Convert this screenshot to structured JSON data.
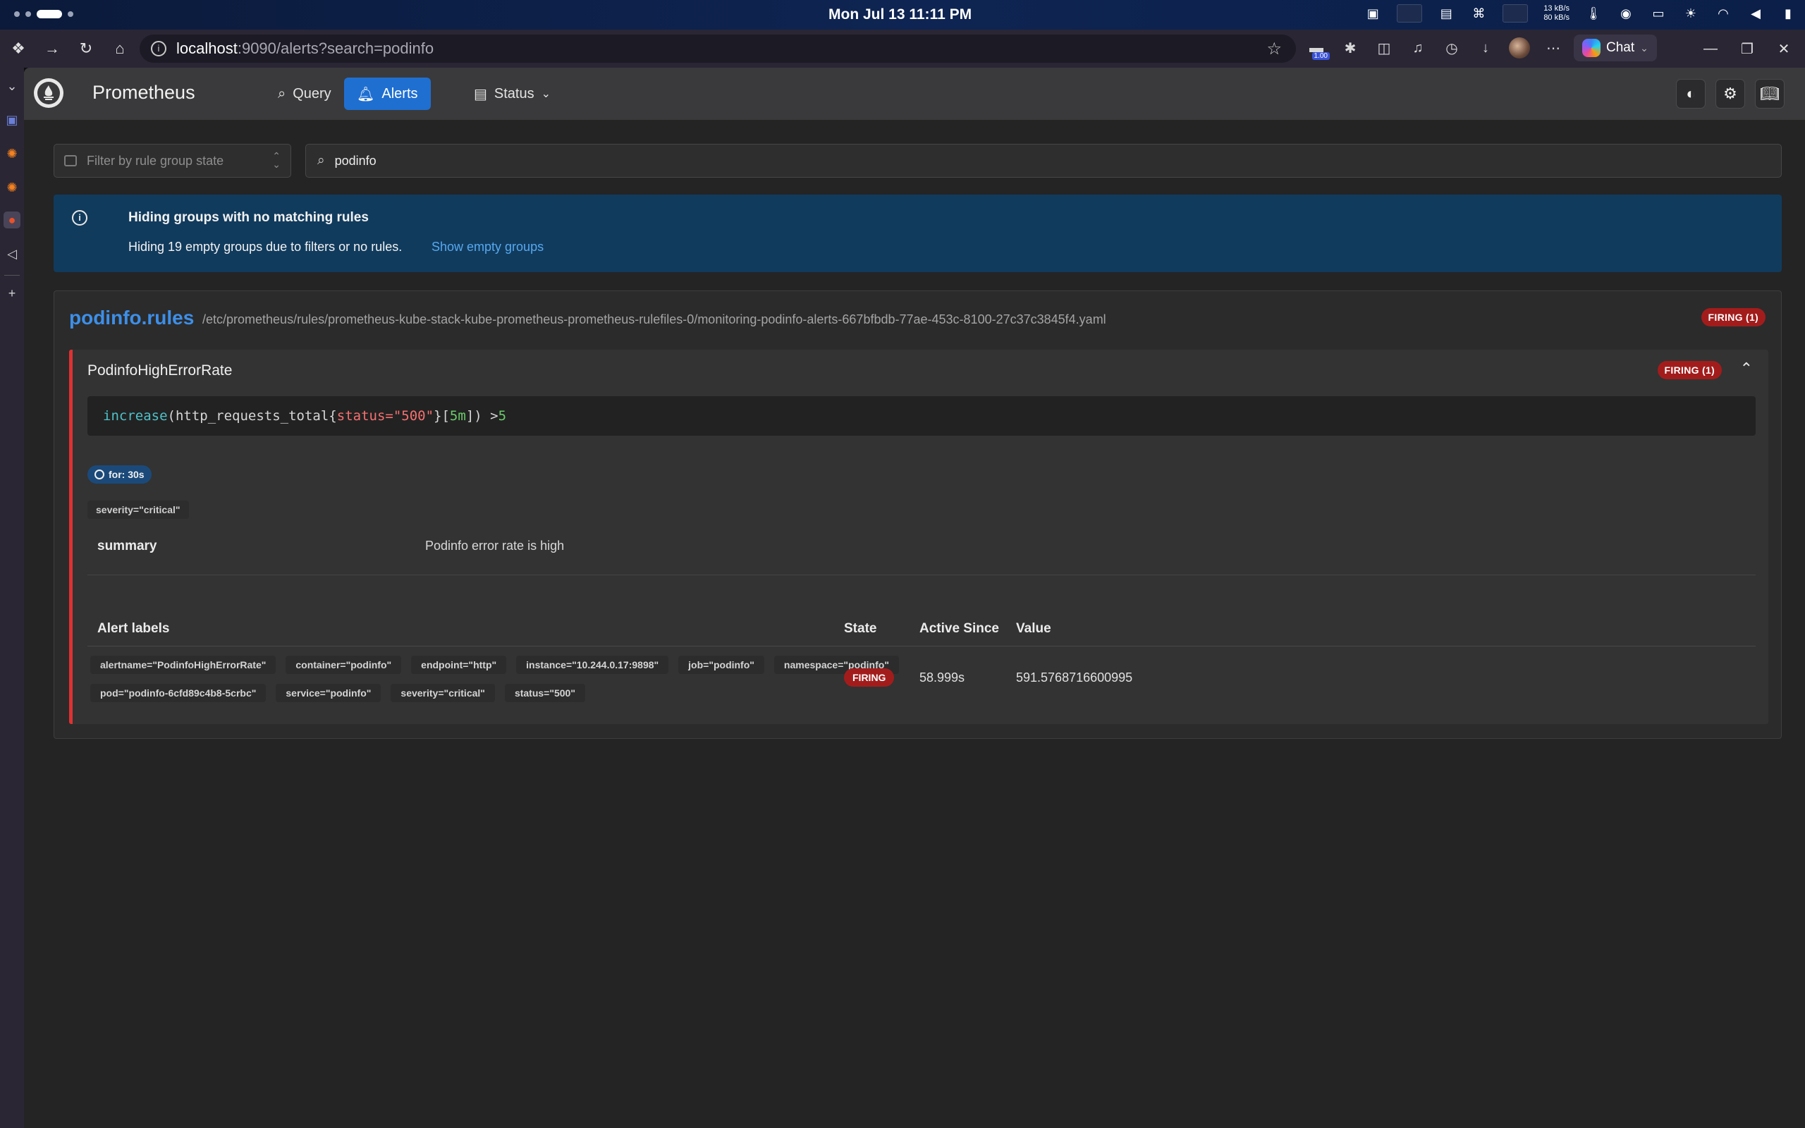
{
  "menubar": {
    "clock": "Mon Jul 13  11:11 PM",
    "net_up": "13 kB/s",
    "net_down": "80 kB/s"
  },
  "browser": {
    "url_host": "localhost",
    "url_rest": ":9090/alerts?search=podinfo",
    "ext_badge": "1.00",
    "chat_label": "Chat"
  },
  "nav": {
    "brand": "Prometheus",
    "query": "Query",
    "alerts": "Alerts",
    "status": "Status"
  },
  "filters": {
    "state_placeholder": "Filter by rule group state",
    "search_value": "podinfo"
  },
  "banner": {
    "title": "Hiding groups with no matching rules",
    "message": "Hiding 19 empty groups due to filters or no rules.",
    "link": "Show empty groups"
  },
  "group": {
    "name": "podinfo.rules",
    "path": "/etc/prometheus/rules/prometheus-kube-stack-kube-prometheus-prometheus-rulefiles-0/monitoring-podinfo-alerts-667bfbdb-77ae-453c-8100-27c37c3845f4.yaml",
    "firing": "FIRING (1)"
  },
  "rule": {
    "name": "PodinfoHighErrorRate",
    "firing": "FIRING (1)",
    "expr": {
      "fn": "increase",
      "p1": "(",
      "metric": "http_requests_total{",
      "label_key": "status=",
      "label_val": "\"500\"",
      "p2": "}[",
      "range": "5m",
      "p3": "]) > ",
      "threshold": "5"
    },
    "for": "for: 30s",
    "severity_label": "severity=\"critical\"",
    "annotation_key": "summary",
    "annotation_value": "Podinfo error rate is high"
  },
  "table": {
    "headers": {
      "labels": "Alert labels",
      "state": "State",
      "active_since": "Active Since",
      "value": "Value"
    },
    "row": {
      "labels": [
        "alertname=\"PodinfoHighErrorRate\"",
        "container=\"podinfo\"",
        "endpoint=\"http\"",
        "instance=\"10.244.0.17:9898\"",
        "job=\"podinfo\"",
        "namespace=\"podinfo\"",
        "pod=\"podinfo-6cfd89c4b8-5crbc\"",
        "service=\"podinfo\"",
        "severity=\"critical\"",
        "status=\"500\""
      ],
      "state": "FIRING",
      "active_since": "58.999s",
      "value": "591.5768716600995"
    }
  }
}
